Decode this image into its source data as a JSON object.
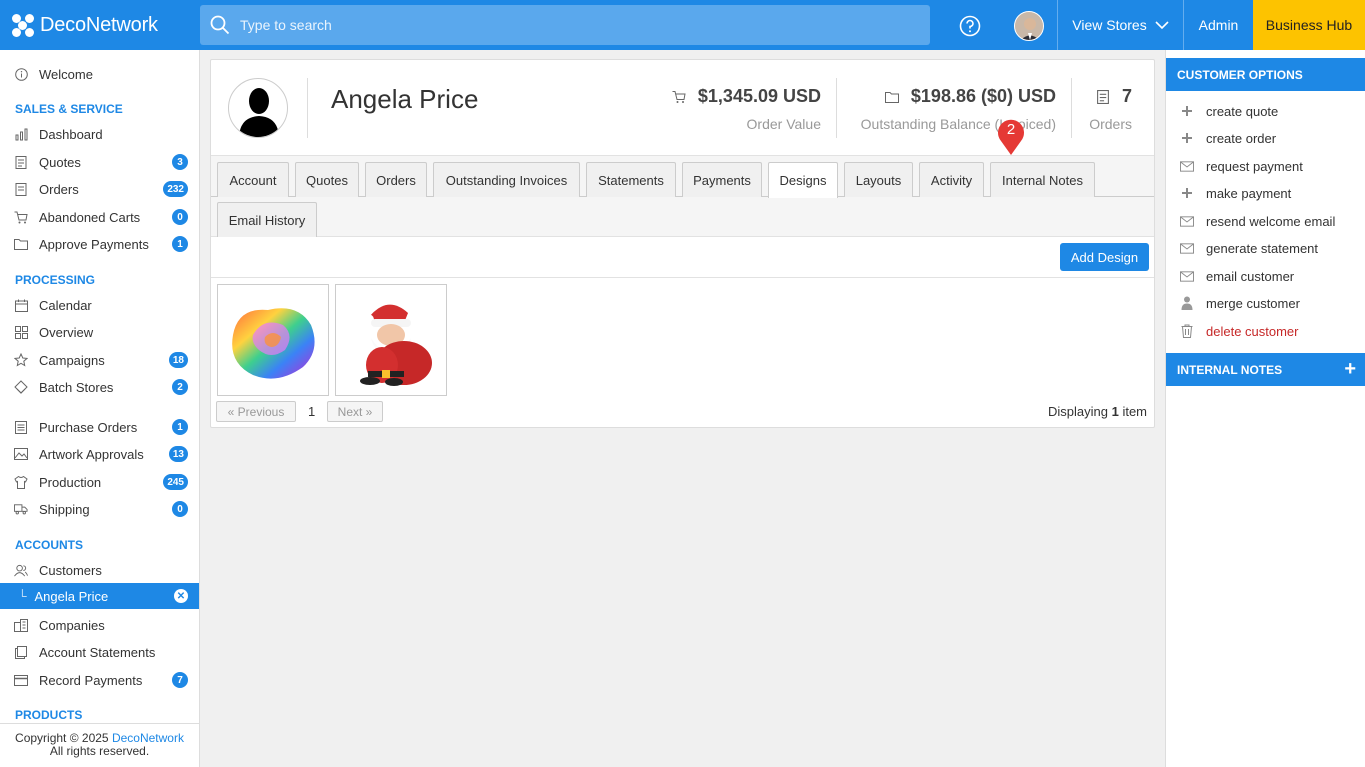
{
  "app": {
    "logo_text": "DecoNetwork",
    "search_placeholder": "Type to search",
    "view_stores": "View Stores",
    "admin": "Admin",
    "business_hub": "Business Hub"
  },
  "sidebar": {
    "welcome": "Welcome",
    "sections": {
      "sales": "SALES & SERVICE",
      "processing": "PROCESSING",
      "accounts": "ACCOUNTS",
      "products": "PRODUCTS"
    },
    "items": {
      "dashboard": "Dashboard",
      "quotes": "Quotes",
      "quotes_count": "3",
      "orders": "Orders",
      "orders_count": "232",
      "abandoned_carts": "Abandoned Carts",
      "abandoned_count": "0",
      "approve_payments": "Approve Payments",
      "approve_count": "1",
      "calendar": "Calendar",
      "overview": "Overview",
      "campaigns": "Campaigns",
      "campaigns_count": "18",
      "batch_stores": "Batch Stores",
      "batch_count": "2",
      "purchase_orders": "Purchase Orders",
      "po_count": "1",
      "artwork_approvals": "Artwork Approvals",
      "artwork_count": "13",
      "production": "Production",
      "production_count": "245",
      "shipping": "Shipping",
      "shipping_count": "0",
      "customers": "Customers",
      "active_customer": "Angela Price",
      "companies": "Companies",
      "account_statements": "Account Statements",
      "record_payments": "Record Payments",
      "record_count": "7"
    },
    "copyright_line1": "Copyright © 2025",
    "copyright_link": "DecoNetwork",
    "copyright_line2": "All rights reserved."
  },
  "customer": {
    "name": "Angela Price",
    "order_value": "$1,345.09 USD",
    "order_value_label": "Order Value",
    "outstanding": "$198.86 ($0) USD",
    "outstanding_label": "Outstanding Balance (Invoiced)",
    "orders": "7",
    "orders_label": "Orders"
  },
  "tabs": [
    "Account",
    "Quotes",
    "Orders",
    "Outstanding Invoices",
    "Statements",
    "Payments",
    "Designs",
    "Layouts",
    "Activity",
    "Internal Notes",
    "Email History"
  ],
  "active_tab": "Designs",
  "notification_pin": "2",
  "designs": {
    "add_button": "Add Design",
    "thumbnails": [
      "rainbow-rose",
      "santa-claus"
    ],
    "prev": "« Previous",
    "page": "1",
    "next": "Next »",
    "displaying_prefix": "Displaying ",
    "displaying_count": "1",
    "displaying_suffix": " item"
  },
  "customer_options": {
    "header": "CUSTOMER OPTIONS",
    "items": [
      "create quote",
      "create order",
      "request payment",
      "make payment",
      "resend welcome email",
      "generate statement",
      "email customer",
      "merge customer",
      "delete customer"
    ]
  },
  "internal_notes": {
    "header": "INTERNAL NOTES",
    "add": "+"
  },
  "colors": {
    "primary": "#1e88e5",
    "business_hub": "#fdc300",
    "danger": "#c62828",
    "pin": "#e53935"
  }
}
